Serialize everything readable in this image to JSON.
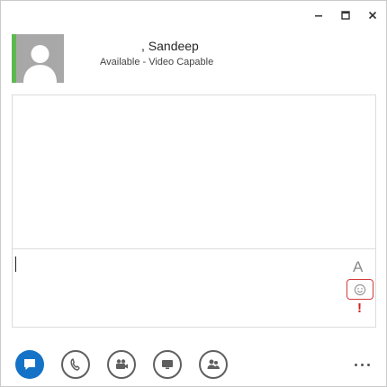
{
  "titlebar": {
    "controls": [
      "minimize-icon",
      "maximize-icon",
      "close-icon"
    ]
  },
  "contact": {
    "name": ", Sandeep",
    "status": "Available - Video Capable",
    "presence_color": "#5db94f",
    "avatar_icon": "person-icon"
  },
  "compose": {
    "font_label": "A",
    "emoticon_icon": "smiley-icon",
    "importance_label": "!"
  },
  "toolbar": {
    "buttons": [
      {
        "name": "im",
        "icon": "chat-bubble-icon",
        "active": true
      },
      {
        "name": "call",
        "icon": "phone-icon",
        "active": false
      },
      {
        "name": "video",
        "icon": "video-camera-icon",
        "active": false
      },
      {
        "name": "present",
        "icon": "monitor-icon",
        "active": false
      },
      {
        "name": "participants",
        "icon": "people-icon",
        "active": false
      }
    ],
    "more_icon": "ellipsis-icon"
  },
  "colors": {
    "accent": "#1473c7",
    "presence_available": "#5db94f",
    "importance": "#d41f1f",
    "highlight_border": "#d43a3a"
  }
}
